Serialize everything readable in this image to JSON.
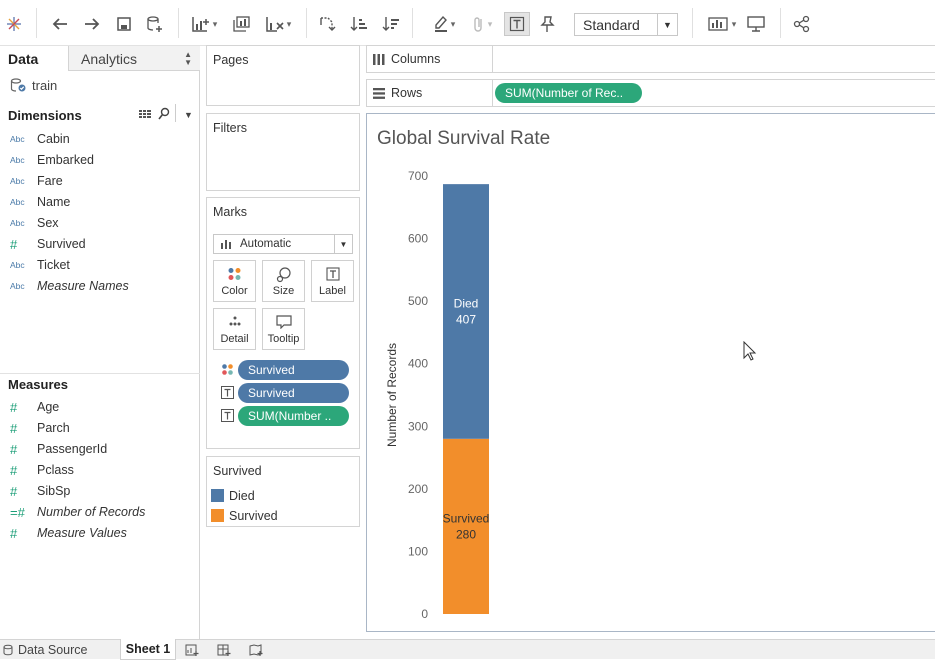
{
  "toolbar": {
    "mark_type_select": "Standard",
    "icons": [
      "tableau-logo-icon",
      "undo-icon",
      "redo-icon",
      "save-icon",
      "new-datasource-icon",
      "new-worksheet-icon",
      "duplicate-sheet-icon",
      "clear-sheet-icon",
      "swap-icon",
      "sort-ascending-icon",
      "sort-descending-icon",
      "highlight-icon",
      "attach-icon",
      "show-labels-icon",
      "pin-icon",
      "show-me-icon",
      "presentation-icon",
      "share-icon"
    ]
  },
  "left_pane": {
    "tab_data": "Data",
    "tab_analytics": "Analytics",
    "datasource": "train",
    "dimensions_title": "Dimensions",
    "dimensions": [
      {
        "label": "Cabin",
        "type": "Abc",
        "italic": false
      },
      {
        "label": "Embarked",
        "type": "Abc",
        "italic": false
      },
      {
        "label": "Fare",
        "type": "Abc",
        "italic": false
      },
      {
        "label": "Name",
        "type": "Abc",
        "italic": false
      },
      {
        "label": "Sex",
        "type": "Abc",
        "italic": false
      },
      {
        "label": "Survived",
        "type": "#",
        "italic": false
      },
      {
        "label": "Ticket",
        "type": "Abc",
        "italic": false
      },
      {
        "label": "Measure Names",
        "type": "Abc",
        "italic": true
      }
    ],
    "measures_title": "Measures",
    "measures": [
      {
        "label": "Age",
        "type": "#",
        "italic": false
      },
      {
        "label": "Parch",
        "type": "#",
        "italic": false
      },
      {
        "label": "PassengerId",
        "type": "#",
        "italic": false
      },
      {
        "label": "Pclass",
        "type": "#",
        "italic": false
      },
      {
        "label": "SibSp",
        "type": "#",
        "italic": false
      },
      {
        "label": "Number of Records",
        "type": "=#",
        "italic": true
      },
      {
        "label": "Measure Values",
        "type": "#",
        "italic": true
      }
    ]
  },
  "cards": {
    "pages": "Pages",
    "filters": "Filters",
    "marks": "Marks",
    "mark_type": "Automatic",
    "mark_buttons": {
      "color": "Color",
      "size": "Size",
      "label": "Label",
      "detail": "Detail",
      "tooltip": "Tooltip"
    },
    "mark_pills": [
      "Survived",
      "Survived",
      "SUM(Number .."
    ],
    "legend_title": "Survived",
    "legend": [
      {
        "label": "Died",
        "color": "#4e79a7"
      },
      {
        "label": "Survived",
        "color": "#f28e2b"
      }
    ]
  },
  "shelves": {
    "columns_label": "Columns",
    "rows_label": "Rows",
    "rows_pill": "SUM(Number of Rec.."
  },
  "chart_data": {
    "type": "bar",
    "title": "Global Survival Rate",
    "ylabel": "Number of Records",
    "ylim": [
      0,
      700
    ],
    "yticks": [
      0,
      100,
      200,
      300,
      400,
      500,
      600,
      700
    ],
    "stacked": true,
    "series": [
      {
        "name": "Survived",
        "value": 280,
        "color": "#f28e2b",
        "label": "Survived\n280"
      },
      {
        "name": "Died",
        "value": 407,
        "color": "#4e79a7",
        "label": "Died\n407"
      }
    ]
  },
  "status": {
    "data_source_tab": "Data Source",
    "sheet_tab": "Sheet 1"
  }
}
